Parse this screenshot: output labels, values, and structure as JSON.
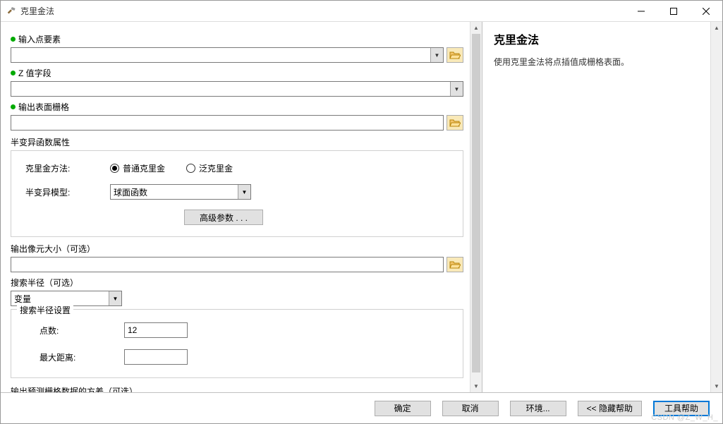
{
  "window": {
    "title": "克里金法"
  },
  "left": {
    "input_point_features_label": "输入点要素",
    "z_field_label": "Z 值字段",
    "output_raster_label": "输出表面栅格",
    "semivariogram_group": "半变异函数属性",
    "kriging_method_label": "克里金方法:",
    "radio_ordinary": "普通克里金",
    "radio_universal": "泛克里金",
    "semivariogram_model_label": "半变异模型:",
    "semivariogram_model_value": "球面函数",
    "advanced_btn": "高级参数 . . .",
    "cellsize_label": "输出像元大小（可选）",
    "search_radius_label": "搜索半径（可选）",
    "search_radius_value": "变量",
    "search_settings_group": "搜索半径设置",
    "num_points_label": "点数:",
    "num_points_value": "12",
    "max_distance_label": "最大距离:",
    "max_distance_value": "",
    "output_variance_label": "输出预测栅格数据的方差（可选）"
  },
  "right": {
    "title": "克里金法",
    "description": "使用克里金法将点插值成栅格表面。"
  },
  "buttons": {
    "ok": "确定",
    "cancel": "取消",
    "environments": "环境...",
    "hide_help": "<< 隐藏帮助",
    "tool_help": "工具帮助"
  },
  "watermark": "CSDN @Z_W_H_"
}
